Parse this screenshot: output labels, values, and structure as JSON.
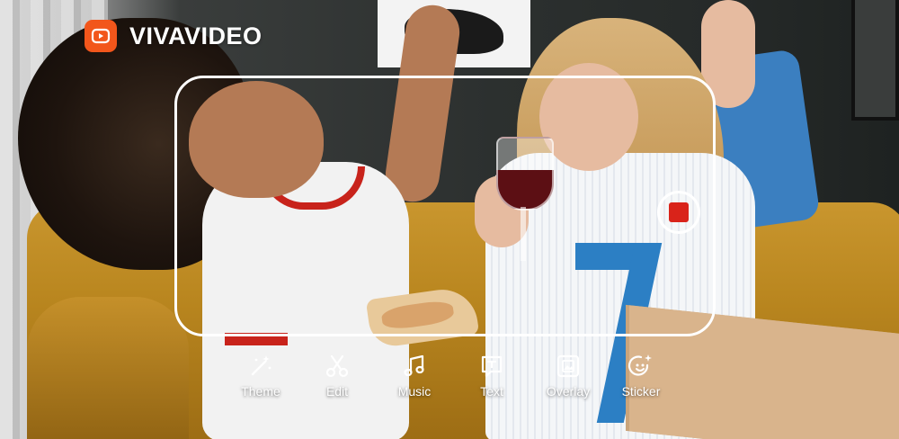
{
  "brand": {
    "name": "VIVAVIDEO",
    "accent": "#f2561b"
  },
  "recorder": {
    "record_color": "#d9231a"
  },
  "toolbar": {
    "items": [
      {
        "label": "Theme",
        "icon": "magic-wand-icon"
      },
      {
        "label": "Edit",
        "icon": "scissors-icon"
      },
      {
        "label": "Music",
        "icon": "music-note-icon"
      },
      {
        "label": "Text",
        "icon": "text-box-icon"
      },
      {
        "label": "Overlay",
        "icon": "overlay-image-icon"
      },
      {
        "label": "Sticker",
        "icon": "sticker-smile-icon"
      }
    ]
  }
}
